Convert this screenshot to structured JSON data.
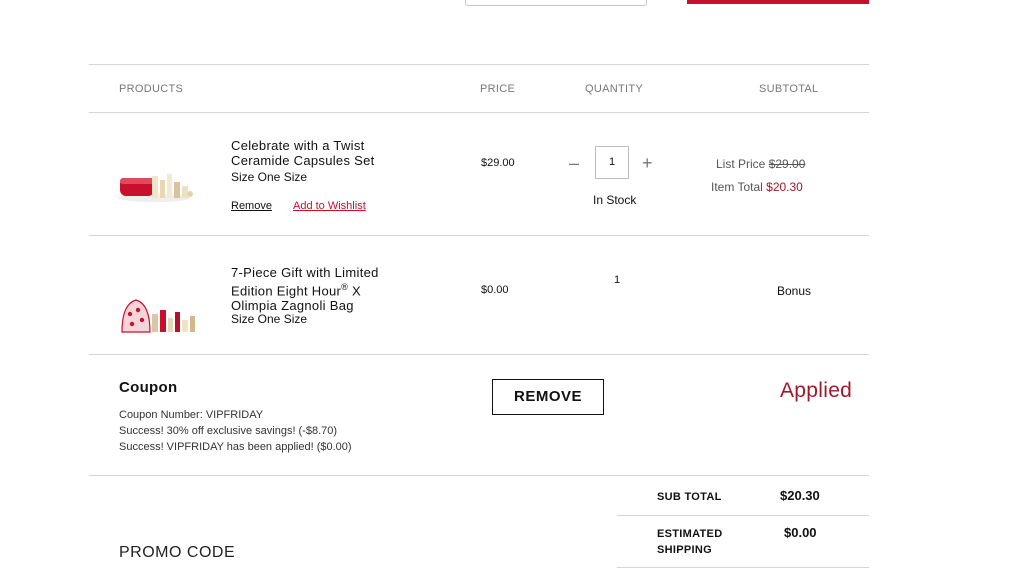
{
  "header": {
    "col_products": "PRODUCTS",
    "col_price": "PRICE",
    "col_quantity": "QUANTITY",
    "col_subtotal": "SUBTOTAL"
  },
  "items": [
    {
      "name_line1": "Celebrate with a Twist",
      "name_line2": "Ceramide Capsules Set",
      "size": "Size One Size",
      "remove_label": "Remove",
      "wishlist_label": "Add to Wishlist",
      "price": "$29.00",
      "qty_minus": "–",
      "quantity": "1",
      "qty_plus": "+",
      "stock": "In Stock",
      "list_price_label": "List Price",
      "list_price": "$29.00",
      "item_total_label": "Item Total",
      "item_total": "$20.30",
      "image_icon": "red-gift-set-icon"
    },
    {
      "name_line1": "7-Piece Gift with Limited",
      "name_line2_a": "Edition Eight Hour",
      "name_line2_sup": "®",
      "name_line2_b": " X",
      "name_line3": "Olimpia Zagnoli Bag",
      "size": "Size One Size",
      "price": "$0.00",
      "quantity": "1",
      "subtotal": "Bonus",
      "image_icon": "gift-bag-set-icon"
    }
  ],
  "coupon": {
    "title": "Coupon",
    "line1": "Coupon Number: VIPFRIDAY",
    "line2": "Success! 30% off exclusive savings! (-$8.70)",
    "line3": "Success! VIPFRIDAY has been applied! ($0.00)",
    "remove_label": "REMOVE",
    "status": "Applied"
  },
  "promo": {
    "label": "PROMO CODE"
  },
  "summary": {
    "subtotal_label": "SUB TOTAL",
    "subtotal_value": "$20.30",
    "shipping_label_line1": "ESTIMATED",
    "shipping_label_line2": "SHIPPING",
    "shipping_value": "$0.00"
  },
  "colors": {
    "accent_red": "#c8102e",
    "price_red": "#a0182a"
  }
}
